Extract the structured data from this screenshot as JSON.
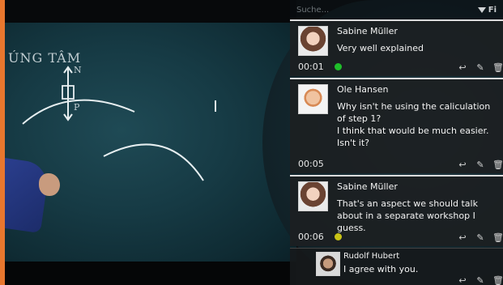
{
  "search": {
    "placeholder": "Suche..."
  },
  "filter": {
    "label": "Fi",
    "icon": "filter-icon"
  },
  "video": {
    "chalk_text": "ÚNG TÂM",
    "chalk_vec": "N",
    "chalk_vec2": "P"
  },
  "comments": [
    {
      "author": "Sabine Müller",
      "text": "Very well explained",
      "time": "00:01",
      "status_color": "#1fbf2a"
    },
    {
      "author": "Ole Hansen",
      "text": "Why isn't he using the caliculation of step 1?\nI think that would be much easier.\nIsn't it?",
      "time": "00:05",
      "status_color": ""
    },
    {
      "author": "Sabine Müller",
      "text": "That's an aspect we should talk about in a separate workshop I guess.",
      "time": "00:06",
      "status_color": "#c9c316"
    },
    {
      "author": "Rudolf Hubert",
      "text": "I agree with you.",
      "time": "",
      "status_color": ""
    }
  ],
  "icons": {
    "reply": "reply-icon",
    "edit": "pencil-icon",
    "delete": "trash-icon"
  },
  "colors": {
    "frame_border": "#e8772e"
  }
}
